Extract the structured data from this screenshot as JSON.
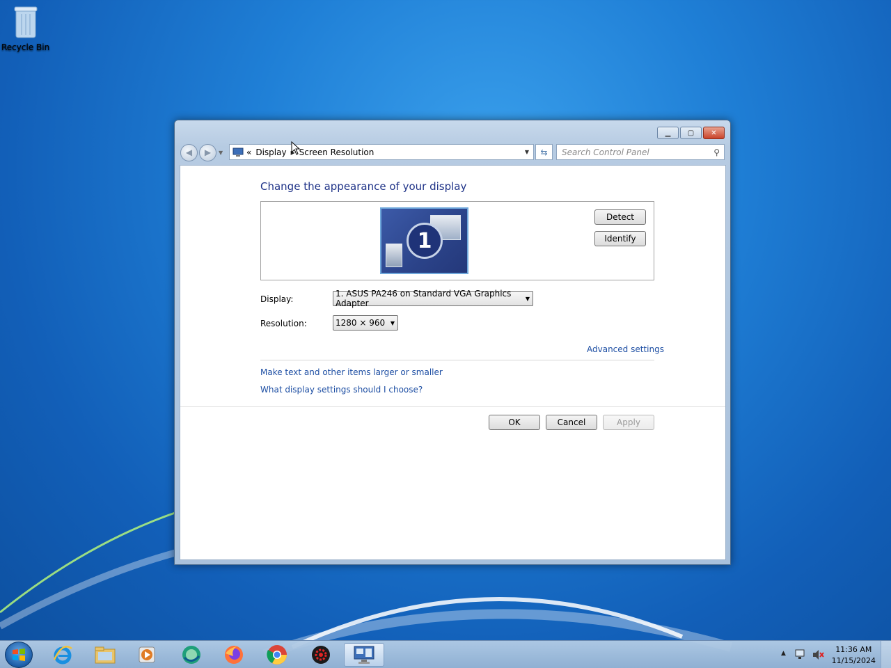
{
  "desktop": {
    "recycle_bin_label": "Recycle Bin"
  },
  "window": {
    "breadcrumb": {
      "overflow": "«",
      "parent": "Display",
      "separator": "▸",
      "current": "Screen Resolution"
    },
    "search_placeholder": "Search Control Panel",
    "heading": "Change the appearance of your display",
    "monitor_number": "1",
    "detect_label": "Detect",
    "identify_label": "Identify",
    "display_label": "Display:",
    "display_value": "1. ASUS PA246 on Standard VGA Graphics Adapter",
    "resolution_label": "Resolution:",
    "resolution_value": "1280 × 960",
    "advanced_link": "Advanced settings",
    "link_text_size": "Make text and other items larger or smaller",
    "link_help": "What display settings should I choose?",
    "ok_label": "OK",
    "cancel_label": "Cancel",
    "apply_label": "Apply"
  },
  "taskbar": {
    "icons": [
      "windows-start-icon",
      "internet-explorer-icon",
      "file-explorer-icon",
      "media-player-icon",
      "browser-green-icon",
      "firefox-icon",
      "chrome-icon",
      "settings-gear-red-icon",
      "display-settings-icon"
    ],
    "time": "11:36 AM",
    "date": "11/15/2024"
  }
}
